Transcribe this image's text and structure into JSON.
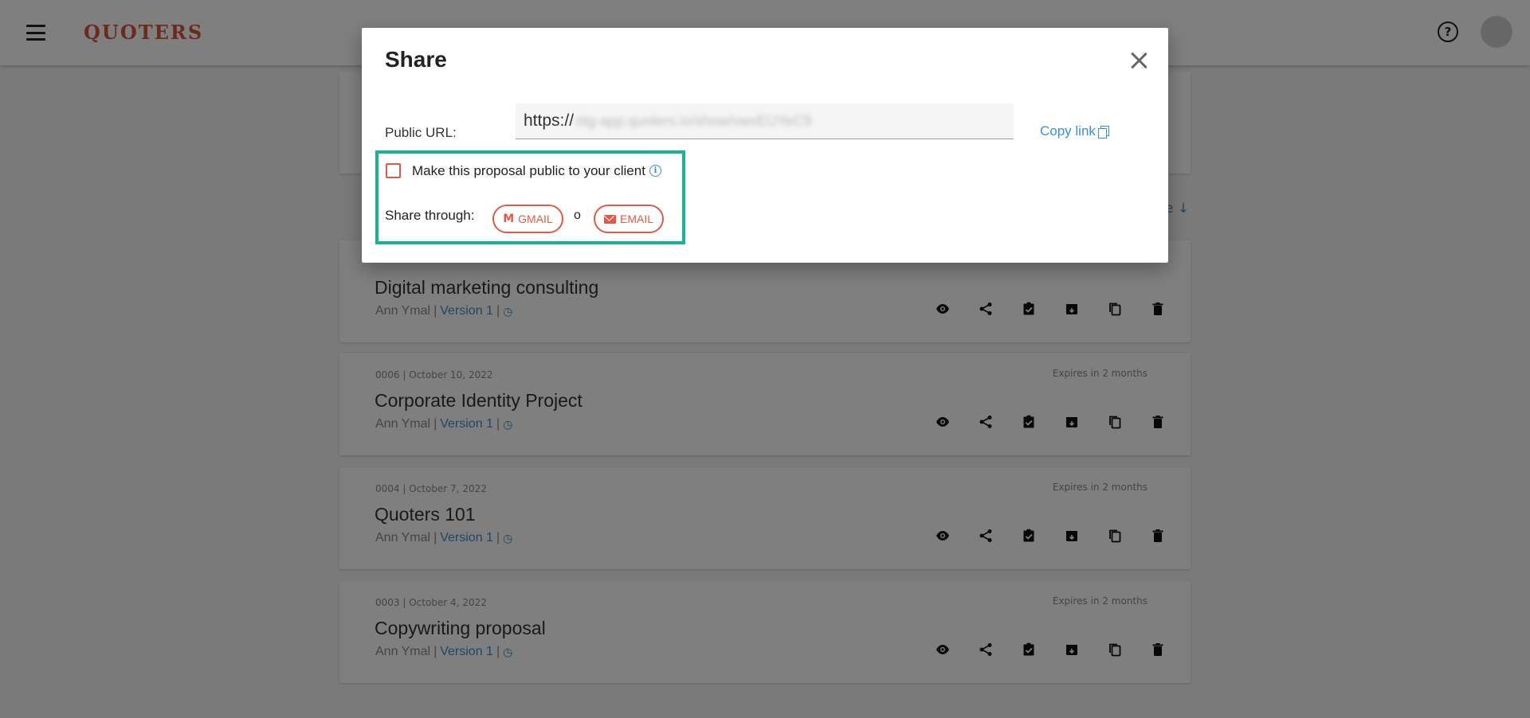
{
  "app": {
    "logo": "QUOTERS",
    "help_icon_glyph": "?"
  },
  "sort_hint": "e ↓",
  "proposals": [
    {
      "meta": "",
      "expires": "",
      "title": "Digital marketing consulting",
      "author": "Ann Ymal",
      "separator": "|",
      "version": "Version 1"
    },
    {
      "meta": "0006 | October 10, 2022",
      "expires": "Expires in 2 months",
      "title": "Corporate Identity Project",
      "author": "Ann Ymal",
      "separator": "|",
      "version": "Version 1"
    },
    {
      "meta": "0004 | October 7, 2022",
      "expires": "Expires in 2 months",
      "title": "Quoters 101",
      "author": "Ann Ymal",
      "separator": "|",
      "version": "Version 1"
    },
    {
      "meta": "0003 | October 4, 2022",
      "expires": "Expires in 2 months",
      "title": "Copywriting proposal",
      "author": "Ann Ymal",
      "separator": "|",
      "version": "Version 1"
    }
  ],
  "action_icons": [
    "eye-icon",
    "share-icon",
    "assignment-check-icon",
    "archive-icon",
    "copy-icon",
    "trash-icon"
  ],
  "modal": {
    "title": "Share",
    "url_label": "Public URL:",
    "url_prefix": "https://",
    "url_blurred": "otg-app.quoters.io/show/vwxEUYeC9",
    "copy_link_label": "Copy link",
    "public_checkbox_label": "Make this proposal public to your client",
    "public_checked": false,
    "info_glyph": "i",
    "share_through_label": "Share through:",
    "gmail_button": "GMAIL",
    "gmail_glyph": "M",
    "or_text": "o",
    "email_button": "EMAIL"
  },
  "colors": {
    "accent_red": "#d9553b",
    "link_blue": "#3a8fd1",
    "highlight_green": "#1bb191"
  }
}
